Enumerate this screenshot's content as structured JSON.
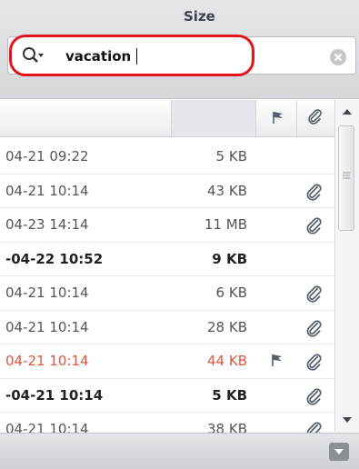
{
  "search": {
    "value": "vacation"
  },
  "columns": {
    "size": "Size"
  },
  "rows": [
    {
      "date": "04-21 09:22",
      "size": "5 KB",
      "attachment": false,
      "flag": false,
      "unread": false,
      "red": false
    },
    {
      "date": "04-21 10:14",
      "size": "43 KB",
      "attachment": true,
      "flag": false,
      "unread": false,
      "red": false
    },
    {
      "date": "04-23 14:14",
      "size": "11 MB",
      "attachment": true,
      "flag": false,
      "unread": false,
      "red": false
    },
    {
      "date": "-04-22 10:52",
      "size": "9 KB",
      "attachment": false,
      "flag": false,
      "unread": true,
      "red": false
    },
    {
      "date": "04-21 10:14",
      "size": "6 KB",
      "attachment": true,
      "flag": false,
      "unread": false,
      "red": false
    },
    {
      "date": "04-21 10:14",
      "size": "28 KB",
      "attachment": true,
      "flag": false,
      "unread": false,
      "red": false
    },
    {
      "date": "04-21 10:14",
      "size": "44 KB",
      "attachment": true,
      "flag": true,
      "unread": false,
      "red": true
    },
    {
      "date": "-04-21 10:14",
      "size": "5 KB",
      "attachment": true,
      "flag": false,
      "unread": true,
      "red": false
    },
    {
      "date": "04-21 10:14",
      "size": "38 KB",
      "attachment": true,
      "flag": false,
      "unread": false,
      "red": false
    }
  ],
  "colors": {
    "highlight": "#e3141a",
    "flaggedText": "#e2553a"
  },
  "icons": {
    "search": "search-icon",
    "clear": "clear-icon",
    "flag": "flag-icon",
    "attachment": "paperclip-icon",
    "menu": "menu-icon"
  }
}
